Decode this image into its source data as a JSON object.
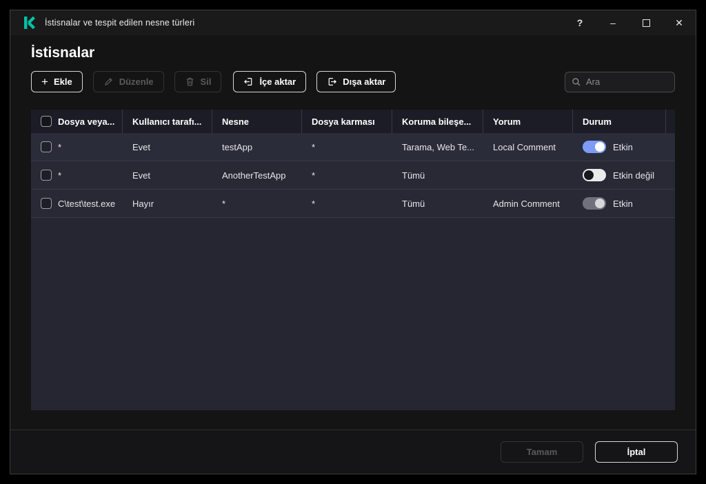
{
  "window": {
    "title": "İstisnalar ve tespit edilen nesne türleri",
    "controls": {
      "help": "?",
      "minimize": "–",
      "close": "✕"
    }
  },
  "page": {
    "title": "İstisnalar"
  },
  "toolbar": {
    "add_label": "Ekle",
    "edit_label": "Düzenle",
    "delete_label": "Sil",
    "import_label": "İçe aktar",
    "export_label": "Dışa aktar",
    "search_placeholder": "Ara"
  },
  "table": {
    "columns": [
      "Dosya veya...",
      "Kullanıcı tarafı...",
      "Nesne",
      "Dosya karması",
      "Koruma bileşe...",
      "Yorum",
      "Durum"
    ],
    "rows": [
      {
        "file": "*",
        "user": "Evet",
        "object": "testApp",
        "hash": "*",
        "component": "Tarama, Web Te...",
        "comment": "Local Comment",
        "status": "Etkin",
        "enabled": true,
        "locked": false
      },
      {
        "file": "*",
        "user": "Evet",
        "object": "AnotherTestApp",
        "hash": "*",
        "component": "Tümü",
        "comment": "",
        "status": "Etkin değil",
        "enabled": false,
        "locked": false
      },
      {
        "file": "C\\test\\test.exe",
        "user": "Hayır",
        "object": "*",
        "hash": "*",
        "component": "Tümü",
        "comment": "Admin Comment",
        "status": "Etkin",
        "enabled": true,
        "locked": true
      }
    ]
  },
  "footer": {
    "ok_label": "Tamam",
    "cancel_label": "İptal"
  },
  "colors": {
    "brand_teal": "#00c3a5",
    "toggle_on": "#7e9cf5",
    "toggle_off_pill": "#ebebeb",
    "toggle_disabled_pill": "#6f727d",
    "table_header_bg": "#1b1c25",
    "row_bg": "#282934",
    "window_bg": "#141414"
  }
}
